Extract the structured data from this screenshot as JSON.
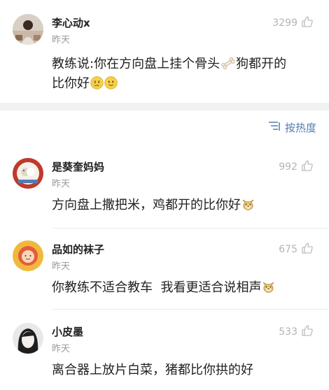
{
  "top_comment": {
    "username": "李心动x",
    "time": "昨天",
    "likes": "3299",
    "text_before": "教练说:你在方向盘上挂个骨头",
    "text_mid": "狗都开的",
    "text_line2": "比你好",
    "emojis": [
      "bone-emoji",
      "sad-face-emoji",
      "smile-face-emoji"
    ]
  },
  "sort": {
    "label": "按热度",
    "icon": "sort-lines-icon"
  },
  "comments": [
    {
      "username": "是葵奎妈妈",
      "time": "昨天",
      "likes": "992",
      "text": "方向盘上撒把米，鸡都开的比你好",
      "emoji": "doge-emoji"
    },
    {
      "username": "品如的袜子",
      "time": "昨天",
      "likes": "675",
      "text": "你教练不适合教车  我看更适合说相声",
      "emoji": "doge-emoji"
    },
    {
      "username": "小皮墨",
      "time": "昨天",
      "likes": "533",
      "text": "离合器上放片白菜，猪都比你拱的好"
    }
  ],
  "colors": {
    "accent_blue": "#4f7db3",
    "muted_gray": "#9a9a9a",
    "divider_gray": "#f2f2f2"
  }
}
